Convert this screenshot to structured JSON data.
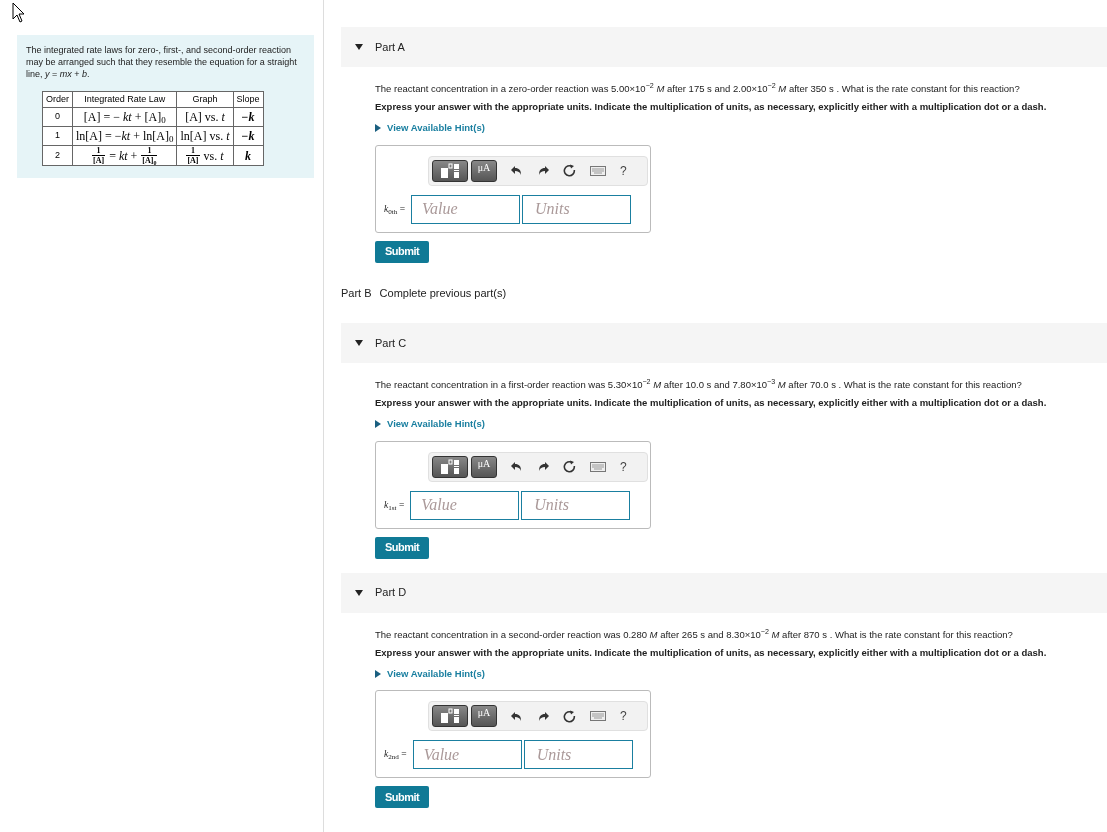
{
  "intro": {
    "text": "The integrated rate laws for zero-, first-, and second-order reaction may be arranged such that they resemble the equation for a straight line, *y* = *mx* + *b*.",
    "table": {
      "columns": [
        "Order",
        "Integrated Rate Law",
        "Graph",
        "Slope"
      ],
      "rows": [
        {
          "order": "0",
          "law": [
            {
              "kind": "text",
              "text": "[A] = − *kt* + [A]$_{0}$"
            }
          ],
          "graph": [
            {
              "kind": "text",
              "text": "[A] vs. *t*"
            }
          ],
          "slope": "−*k*"
        },
        {
          "order": "1",
          "law": [
            {
              "kind": "text",
              "text": "ln[A] = −*kt* + ln[A]$_{0}$"
            }
          ],
          "graph": [
            {
              "kind": "text",
              "text": "ln[A] vs. *t*"
            }
          ],
          "slope": "−*k*"
        },
        {
          "order": "2",
          "law": [
            {
              "kind": "frac",
              "num": "1",
              "den": "[A]"
            },
            {
              "kind": "text",
              "text": "= *kt* +"
            },
            {
              "kind": "frac",
              "num": "1",
              "den": "[A]$_{0}$"
            }
          ],
          "graph": [
            {
              "kind": "frac",
              "num": "1",
              "den": "[A]"
            },
            {
              "kind": "text",
              "text": "vs. *t*"
            }
          ],
          "slope": "*k*"
        }
      ]
    }
  },
  "parts": [
    {
      "kind": "question",
      "title": "Part A",
      "expanded": true,
      "question": "The reactant concentration in a zero-order reaction was 5.00×10$^{−2}$ *M* after 175 s and 2.00×10$^{−2}$ *M* after 350 s . What is the rate constant for this reaction?",
      "instructions": "Express your answer with the appropriate units. Indicate the multiplication of units, as necessary, explicitly either with a multiplication dot or a dash.",
      "hint": "View Available Hint(s)",
      "toolbar": {
        "units_label": "μA",
        "help_label": "?"
      },
      "answer_label": "*k*$_{0th}$ =",
      "value_placeholder": "Value",
      "units_placeholder": "Units",
      "submit": "Submit"
    },
    {
      "kind": "locked",
      "title": "Part B",
      "status": "Complete previous part(s)"
    },
    {
      "kind": "question",
      "title": "Part C",
      "expanded": true,
      "question": "The reactant concentration in a first-order reaction was 5.30×10$^{−2}$ *M* after 10.0 s and 7.80×10$^{−3}$ *M* after 70.0 s . What is the rate constant for this reaction?",
      "instructions": "Express your answer with the appropriate units. Indicate the multiplication of units, as necessary, explicitly either with a multiplication dot or a dash.",
      "hint": "View Available Hint(s)",
      "toolbar": {
        "units_label": "μA",
        "help_label": "?"
      },
      "answer_label": "*k*$_{1st}$ =",
      "value_placeholder": "Value",
      "units_placeholder": "Units",
      "submit": "Submit"
    },
    {
      "kind": "question",
      "title": "Part D",
      "expanded": true,
      "question": "The reactant concentration in a second-order reaction was 0.280 *M* after 265 s and 8.30×10$^{−2}$ *M* after 870 s . What is the rate constant for this reaction?",
      "instructions": "Express your answer with the appropriate units. Indicate the multiplication of units, as necessary, explicitly either with a multiplication dot or a dash.",
      "hint": "View Available Hint(s)",
      "toolbar": {
        "units_label": "μA",
        "help_label": "?"
      },
      "answer_label": "*k*$_{2nd}$ =",
      "value_placeholder": "Value",
      "units_placeholder": "Units",
      "submit": "Submit"
    }
  ]
}
